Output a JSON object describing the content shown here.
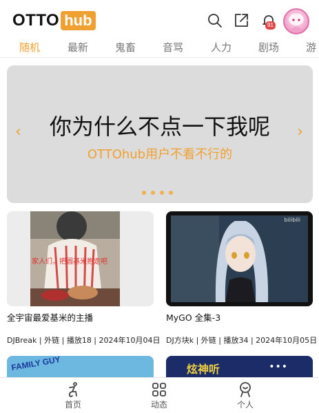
{
  "header": {
    "logo_text": "OTTO",
    "logo_badge": "hub",
    "notification_count": "91",
    "icons": [
      "search-icon",
      "share-icon",
      "bell-icon"
    ]
  },
  "tabs": [
    {
      "label": "随机",
      "active": true
    },
    {
      "label": "最新",
      "active": false
    },
    {
      "label": "鬼畜",
      "active": false
    },
    {
      "label": "音骂",
      "active": false
    },
    {
      "label": "人力",
      "active": false
    },
    {
      "label": "剧场",
      "active": false
    },
    {
      "label": "游",
      "active": false
    }
  ],
  "banner": {
    "title": "你为什么不点一下我呢",
    "subtitle": "OTTOhub用户不看不行的",
    "prev": "‹",
    "next": "›",
    "dot_count": 4
  },
  "videos": [
    {
      "title": "全宇宙最爱基米的主播",
      "meta": "DJBreak | 外链 | 播放18 | 2024年10月04日",
      "caption": "家人们，把圆基米抱走吧"
    },
    {
      "title": "MyGO 全集-3",
      "meta": "DJ方块k | 外链 | 播放34 | 2024年10月05日",
      "watermark": "bilibili"
    }
  ],
  "next_row": [
    {
      "caption": "FAMILY GUY"
    },
    {
      "caption": "炫神听"
    }
  ],
  "bottom_nav": [
    {
      "label": "首页",
      "icon": "home-icon"
    },
    {
      "label": "动态",
      "icon": "grid-icon"
    },
    {
      "label": "个人",
      "icon": "person-icon"
    }
  ],
  "colors": {
    "accent": "#f0a030",
    "badge": "#e04848",
    "banner_bg": "#dcdcdc"
  }
}
